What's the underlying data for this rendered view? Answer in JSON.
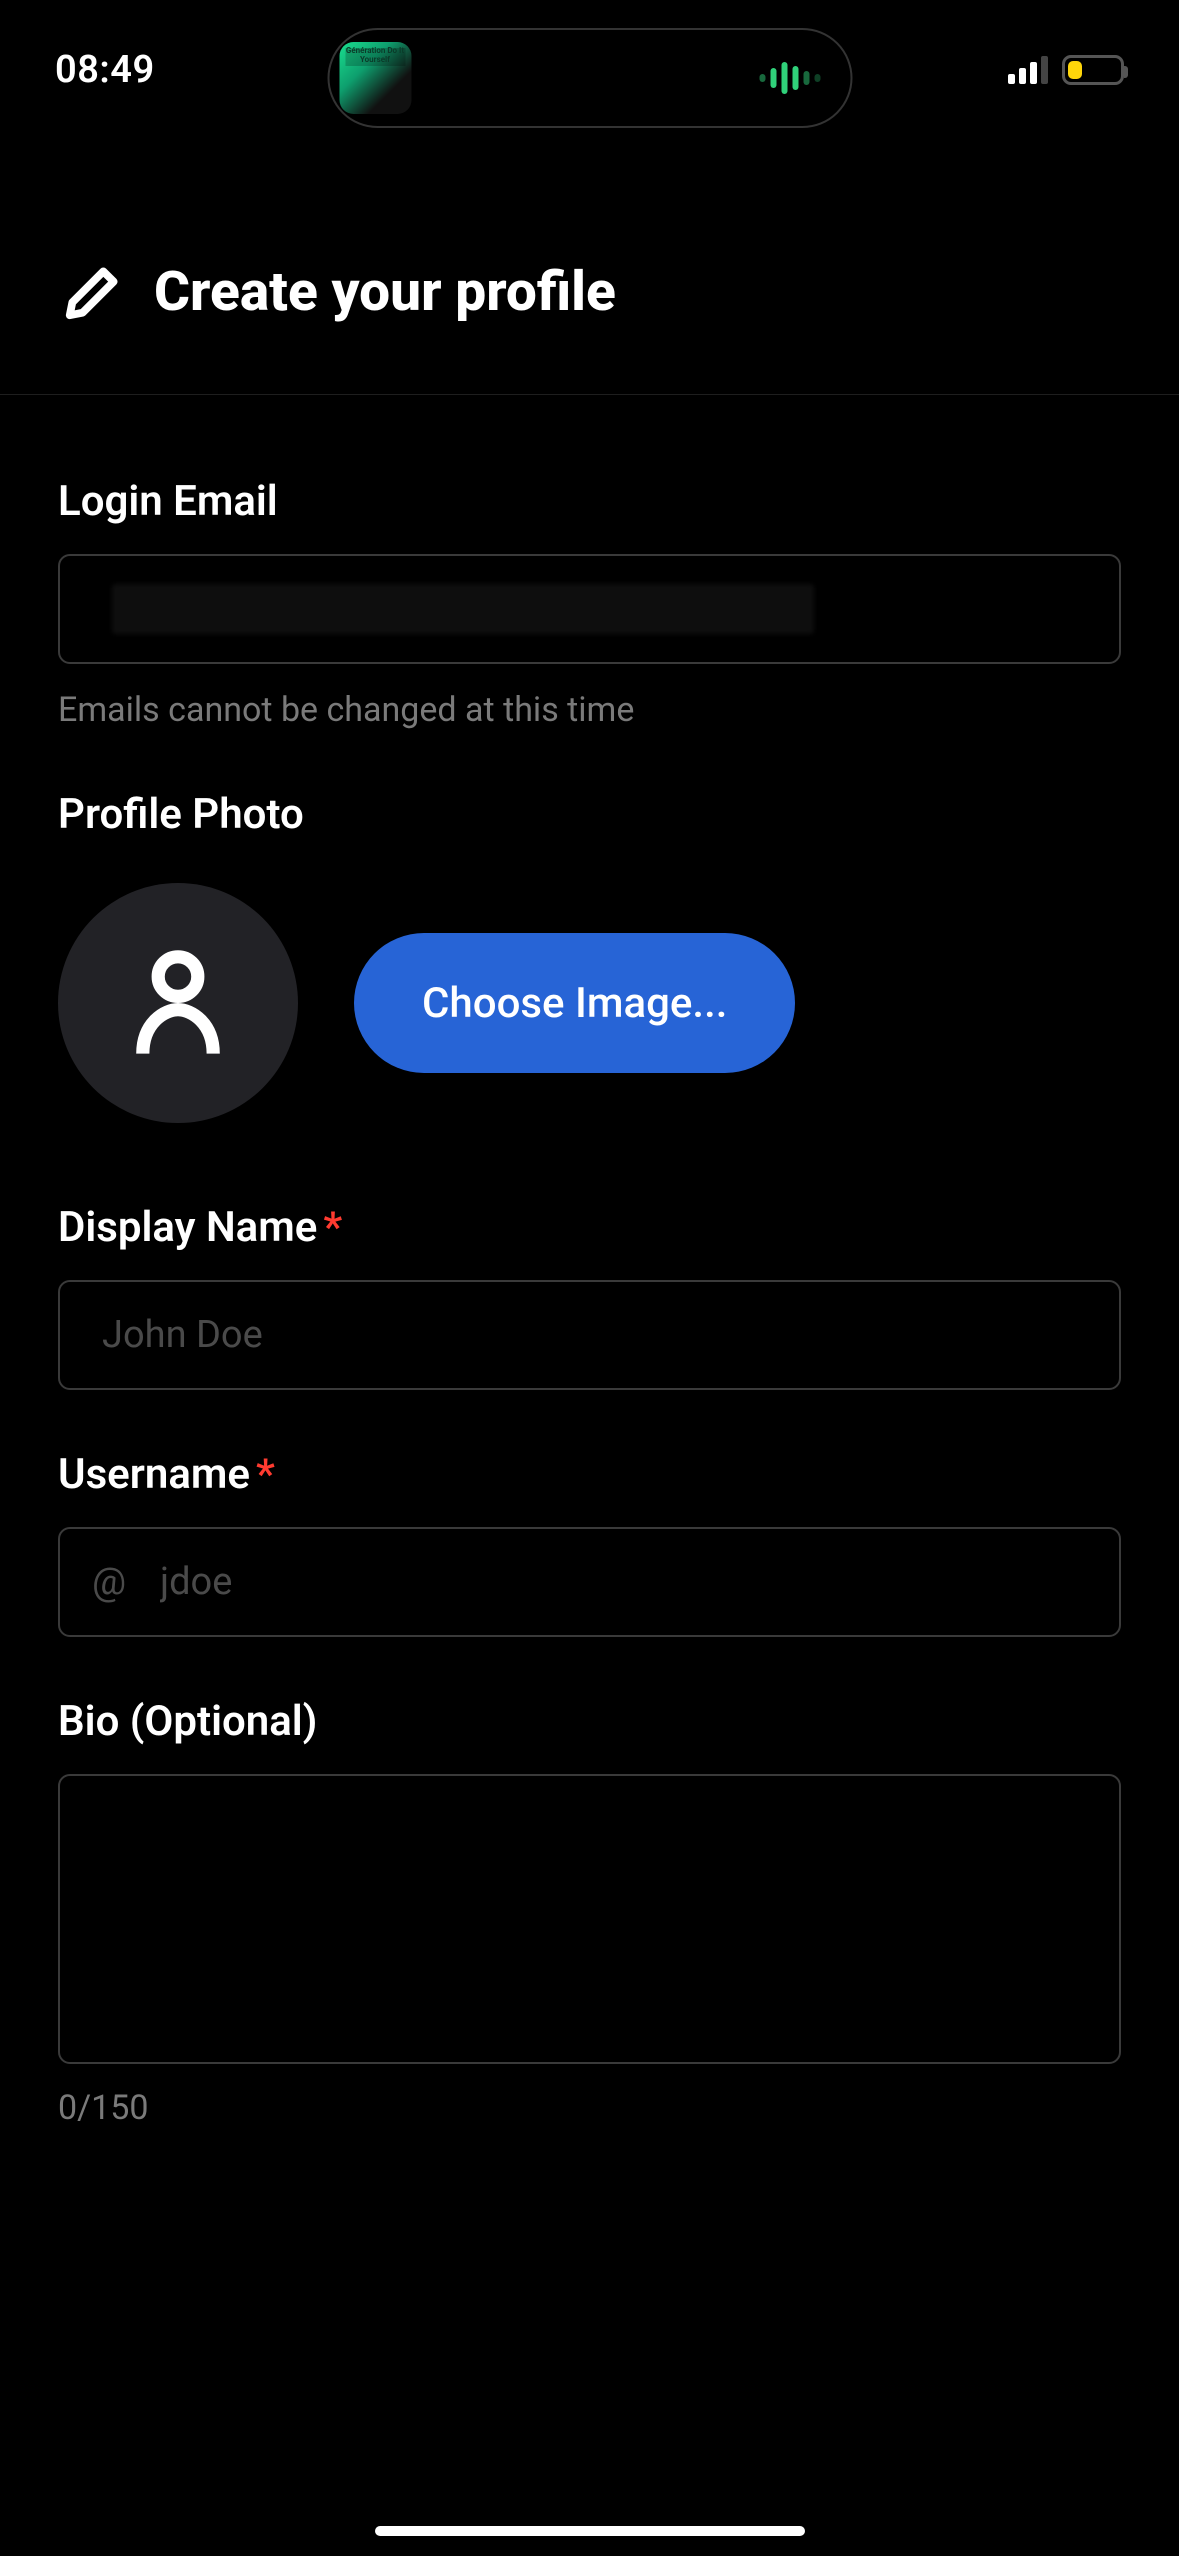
{
  "status_bar": {
    "time": "08:49",
    "island": {
      "album_text": "Génération Do It Yourself"
    }
  },
  "header": {
    "title": "Create your profile"
  },
  "fields": {
    "email": {
      "label": "Login Email",
      "help": "Emails cannot be changed at this time"
    },
    "photo": {
      "label": "Profile Photo",
      "button": "Choose Image..."
    },
    "display_name": {
      "label": "Display Name",
      "placeholder": "John Doe"
    },
    "username": {
      "label": "Username",
      "prefix": "@",
      "placeholder": "jdoe"
    },
    "bio": {
      "label": "Bio (Optional)",
      "counter": "0/150"
    }
  }
}
